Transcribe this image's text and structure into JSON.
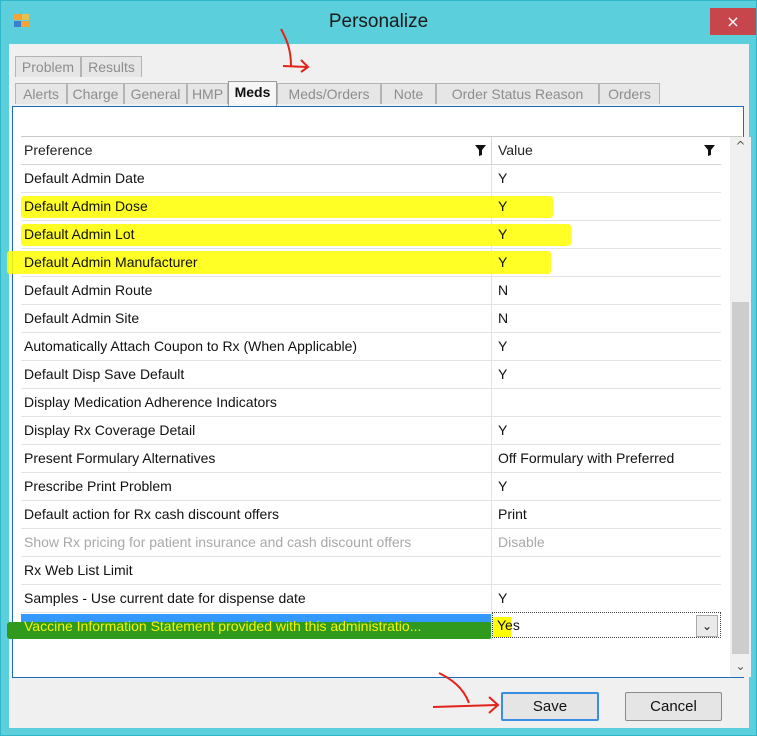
{
  "window": {
    "title": "Personalize",
    "close_label": "×"
  },
  "tabs_top": [
    {
      "label": "Problem"
    },
    {
      "label": "Results"
    }
  ],
  "tabs": [
    {
      "label": "Alerts"
    },
    {
      "label": "Charge"
    },
    {
      "label": "General"
    },
    {
      "label": "HMP"
    },
    {
      "label": "Meds",
      "active": true
    },
    {
      "label": "Meds/Orders"
    },
    {
      "label": "Note"
    },
    {
      "label": "Order Status Reason"
    },
    {
      "label": "Orders"
    }
  ],
  "grid": {
    "columns": [
      "Preference",
      "Value"
    ],
    "rows": [
      {
        "pref": "Default Admin Date",
        "value": "Y"
      },
      {
        "pref": "Default Admin Dose",
        "value": "Y",
        "highlight": true
      },
      {
        "pref": "Default Admin Lot",
        "value": "Y",
        "highlight": true
      },
      {
        "pref": "Default Admin Manufacturer",
        "value": "Y",
        "highlight": true
      },
      {
        "pref": "Default Admin Route",
        "value": "N"
      },
      {
        "pref": "Default Admin Site",
        "value": "N"
      },
      {
        "pref": "Automatically Attach Coupon to Rx (When Applicable)",
        "value": "Y"
      },
      {
        "pref": "Default Disp Save Default",
        "value": "Y"
      },
      {
        "pref": "Display Medication Adherence Indicators",
        "value": ""
      },
      {
        "pref": "Display Rx Coverage Detail",
        "value": "Y"
      },
      {
        "pref": "Present Formulary Alternatives",
        "value": "Off Formulary with Preferred"
      },
      {
        "pref": "Prescribe Print Problem",
        "value": "Y"
      },
      {
        "pref": "Default action for Rx cash discount offers",
        "value": "Print"
      },
      {
        "pref": "Show Rx pricing for patient insurance and cash discount offers",
        "value": "Disable",
        "disabled": true
      },
      {
        "pref": "Rx Web List Limit",
        "value": ""
      },
      {
        "pref": "Samples - Use current date for dispense date",
        "value": "Y"
      }
    ],
    "edit_row": {
      "pref": "Vaccine Information Statement provided with this administratio...",
      "value": "Yes"
    }
  },
  "buttons": {
    "save": "Save",
    "cancel": "Cancel"
  },
  "colors": {
    "title_bar": "#5ccfdc",
    "highlight": "#ffff00",
    "selection": "#3399ff",
    "close": "#c6464b"
  }
}
